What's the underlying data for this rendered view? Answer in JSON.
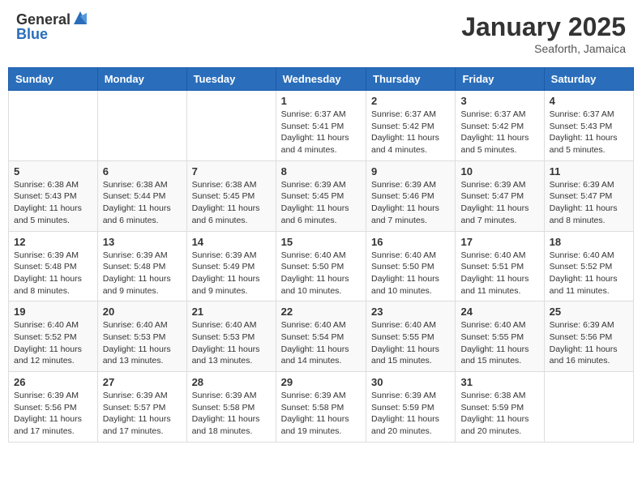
{
  "header": {
    "logo_general": "General",
    "logo_blue": "Blue",
    "month_title": "January 2025",
    "subtitle": "Seaforth, Jamaica"
  },
  "weekdays": [
    "Sunday",
    "Monday",
    "Tuesday",
    "Wednesday",
    "Thursday",
    "Friday",
    "Saturday"
  ],
  "weeks": [
    [
      {
        "day": "",
        "sunrise": "",
        "sunset": "",
        "daylight": ""
      },
      {
        "day": "",
        "sunrise": "",
        "sunset": "",
        "daylight": ""
      },
      {
        "day": "",
        "sunrise": "",
        "sunset": "",
        "daylight": ""
      },
      {
        "day": "1",
        "sunrise": "Sunrise: 6:37 AM",
        "sunset": "Sunset: 5:41 PM",
        "daylight": "Daylight: 11 hours and 4 minutes."
      },
      {
        "day": "2",
        "sunrise": "Sunrise: 6:37 AM",
        "sunset": "Sunset: 5:42 PM",
        "daylight": "Daylight: 11 hours and 4 minutes."
      },
      {
        "day": "3",
        "sunrise": "Sunrise: 6:37 AM",
        "sunset": "Sunset: 5:42 PM",
        "daylight": "Daylight: 11 hours and 5 minutes."
      },
      {
        "day": "4",
        "sunrise": "Sunrise: 6:37 AM",
        "sunset": "Sunset: 5:43 PM",
        "daylight": "Daylight: 11 hours and 5 minutes."
      }
    ],
    [
      {
        "day": "5",
        "sunrise": "Sunrise: 6:38 AM",
        "sunset": "Sunset: 5:43 PM",
        "daylight": "Daylight: 11 hours and 5 minutes."
      },
      {
        "day": "6",
        "sunrise": "Sunrise: 6:38 AM",
        "sunset": "Sunset: 5:44 PM",
        "daylight": "Daylight: 11 hours and 6 minutes."
      },
      {
        "day": "7",
        "sunrise": "Sunrise: 6:38 AM",
        "sunset": "Sunset: 5:45 PM",
        "daylight": "Daylight: 11 hours and 6 minutes."
      },
      {
        "day": "8",
        "sunrise": "Sunrise: 6:39 AM",
        "sunset": "Sunset: 5:45 PM",
        "daylight": "Daylight: 11 hours and 6 minutes."
      },
      {
        "day": "9",
        "sunrise": "Sunrise: 6:39 AM",
        "sunset": "Sunset: 5:46 PM",
        "daylight": "Daylight: 11 hours and 7 minutes."
      },
      {
        "day": "10",
        "sunrise": "Sunrise: 6:39 AM",
        "sunset": "Sunset: 5:47 PM",
        "daylight": "Daylight: 11 hours and 7 minutes."
      },
      {
        "day": "11",
        "sunrise": "Sunrise: 6:39 AM",
        "sunset": "Sunset: 5:47 PM",
        "daylight": "Daylight: 11 hours and 8 minutes."
      }
    ],
    [
      {
        "day": "12",
        "sunrise": "Sunrise: 6:39 AM",
        "sunset": "Sunset: 5:48 PM",
        "daylight": "Daylight: 11 hours and 8 minutes."
      },
      {
        "day": "13",
        "sunrise": "Sunrise: 6:39 AM",
        "sunset": "Sunset: 5:48 PM",
        "daylight": "Daylight: 11 hours and 9 minutes."
      },
      {
        "day": "14",
        "sunrise": "Sunrise: 6:39 AM",
        "sunset": "Sunset: 5:49 PM",
        "daylight": "Daylight: 11 hours and 9 minutes."
      },
      {
        "day": "15",
        "sunrise": "Sunrise: 6:40 AM",
        "sunset": "Sunset: 5:50 PM",
        "daylight": "Daylight: 11 hours and 10 minutes."
      },
      {
        "day": "16",
        "sunrise": "Sunrise: 6:40 AM",
        "sunset": "Sunset: 5:50 PM",
        "daylight": "Daylight: 11 hours and 10 minutes."
      },
      {
        "day": "17",
        "sunrise": "Sunrise: 6:40 AM",
        "sunset": "Sunset: 5:51 PM",
        "daylight": "Daylight: 11 hours and 11 minutes."
      },
      {
        "day": "18",
        "sunrise": "Sunrise: 6:40 AM",
        "sunset": "Sunset: 5:52 PM",
        "daylight": "Daylight: 11 hours and 11 minutes."
      }
    ],
    [
      {
        "day": "19",
        "sunrise": "Sunrise: 6:40 AM",
        "sunset": "Sunset: 5:52 PM",
        "daylight": "Daylight: 11 hours and 12 minutes."
      },
      {
        "day": "20",
        "sunrise": "Sunrise: 6:40 AM",
        "sunset": "Sunset: 5:53 PM",
        "daylight": "Daylight: 11 hours and 13 minutes."
      },
      {
        "day": "21",
        "sunrise": "Sunrise: 6:40 AM",
        "sunset": "Sunset: 5:53 PM",
        "daylight": "Daylight: 11 hours and 13 minutes."
      },
      {
        "day": "22",
        "sunrise": "Sunrise: 6:40 AM",
        "sunset": "Sunset: 5:54 PM",
        "daylight": "Daylight: 11 hours and 14 minutes."
      },
      {
        "day": "23",
        "sunrise": "Sunrise: 6:40 AM",
        "sunset": "Sunset: 5:55 PM",
        "daylight": "Daylight: 11 hours and 15 minutes."
      },
      {
        "day": "24",
        "sunrise": "Sunrise: 6:40 AM",
        "sunset": "Sunset: 5:55 PM",
        "daylight": "Daylight: 11 hours and 15 minutes."
      },
      {
        "day": "25",
        "sunrise": "Sunrise: 6:39 AM",
        "sunset": "Sunset: 5:56 PM",
        "daylight": "Daylight: 11 hours and 16 minutes."
      }
    ],
    [
      {
        "day": "26",
        "sunrise": "Sunrise: 6:39 AM",
        "sunset": "Sunset: 5:56 PM",
        "daylight": "Daylight: 11 hours and 17 minutes."
      },
      {
        "day": "27",
        "sunrise": "Sunrise: 6:39 AM",
        "sunset": "Sunset: 5:57 PM",
        "daylight": "Daylight: 11 hours and 17 minutes."
      },
      {
        "day": "28",
        "sunrise": "Sunrise: 6:39 AM",
        "sunset": "Sunset: 5:58 PM",
        "daylight": "Daylight: 11 hours and 18 minutes."
      },
      {
        "day": "29",
        "sunrise": "Sunrise: 6:39 AM",
        "sunset": "Sunset: 5:58 PM",
        "daylight": "Daylight: 11 hours and 19 minutes."
      },
      {
        "day": "30",
        "sunrise": "Sunrise: 6:39 AM",
        "sunset": "Sunset: 5:59 PM",
        "daylight": "Daylight: 11 hours and 20 minutes."
      },
      {
        "day": "31",
        "sunrise": "Sunrise: 6:38 AM",
        "sunset": "Sunset: 5:59 PM",
        "daylight": "Daylight: 11 hours and 20 minutes."
      },
      {
        "day": "",
        "sunrise": "",
        "sunset": "",
        "daylight": ""
      }
    ]
  ]
}
